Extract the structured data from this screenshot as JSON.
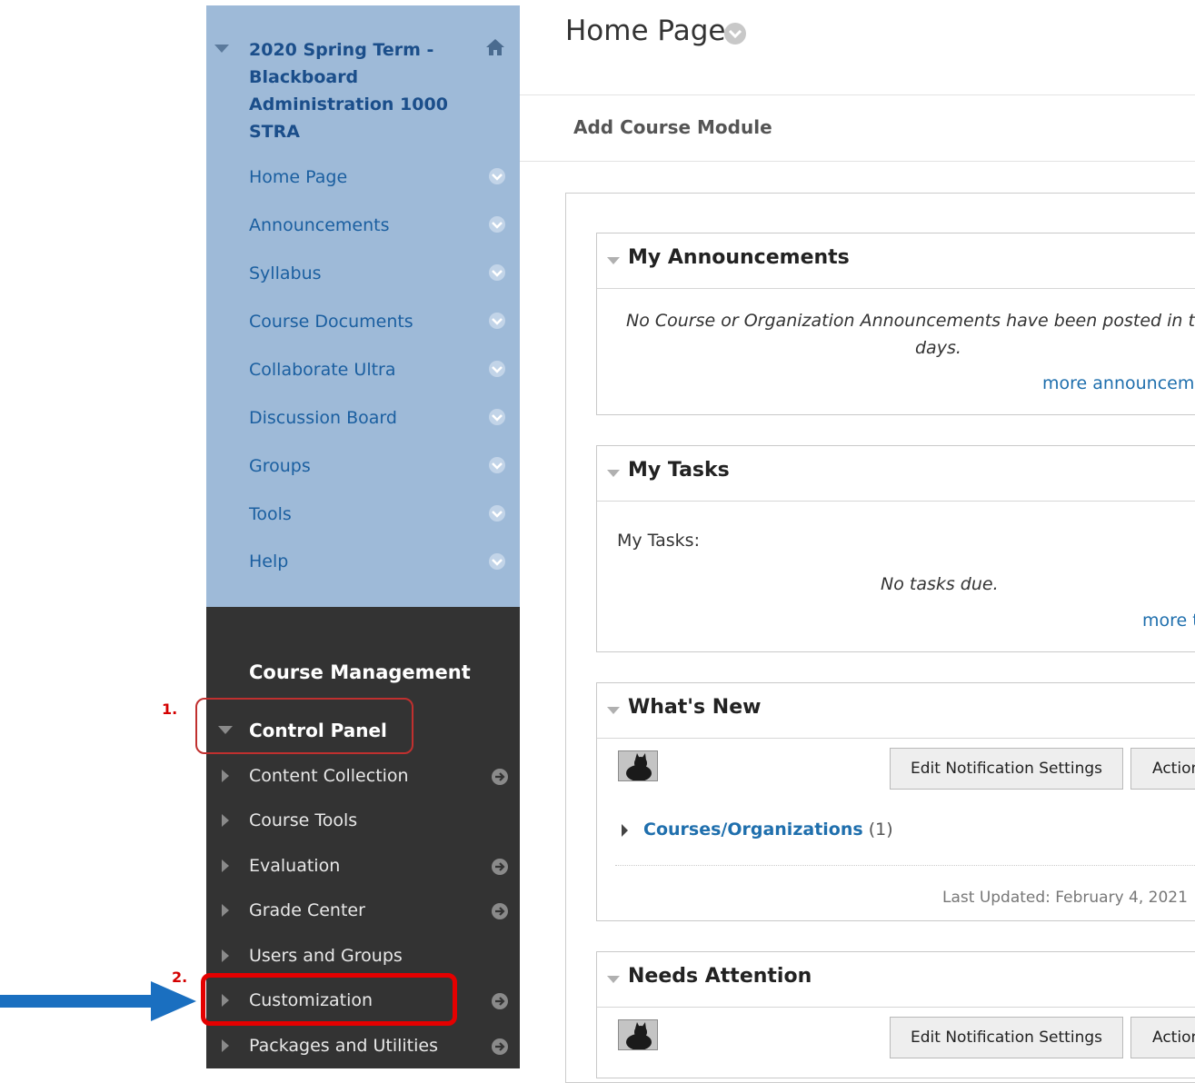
{
  "sidebar": {
    "course_title": "2020 Spring Term - Blackboard Administration 1000 STRA",
    "items": [
      {
        "label": "Home Page"
      },
      {
        "label": "Announcements"
      },
      {
        "label": "Syllabus"
      },
      {
        "label": "Course Documents"
      },
      {
        "label": "Collaborate Ultra"
      },
      {
        "label": "Discussion Board"
      },
      {
        "label": "Groups"
      },
      {
        "label": "Tools"
      },
      {
        "label": "Help"
      }
    ]
  },
  "course_management": {
    "title": "Course Management",
    "control_panel": "Control Panel",
    "items": [
      {
        "label": "Content Collection"
      },
      {
        "label": "Course Tools"
      },
      {
        "label": "Evaluation"
      },
      {
        "label": "Grade Center"
      },
      {
        "label": "Users and Groups"
      },
      {
        "label": "Customization"
      },
      {
        "label": "Packages and Utilities"
      }
    ]
  },
  "annotations": {
    "step1": "1.",
    "step2": "2."
  },
  "main": {
    "page_title": "Home Page",
    "add_module": "Add Course Module",
    "modules": {
      "announcements": {
        "title": "My Announcements",
        "message_line1": "No Course or Organization Announcements have been posted in the",
        "message_line2": "days.",
        "more_link": "more announcements"
      },
      "tasks": {
        "title": "My Tasks",
        "label": "My Tasks:",
        "message": "No tasks due.",
        "more_link": "more tasks"
      },
      "whats_new": {
        "title": "What's New",
        "edit_button": "Edit Notification Settings",
        "actions_button": "Actions",
        "courses_link": "Courses/Organizations",
        "courses_count": "(1)",
        "last_updated": "Last Updated: February 4, 2021"
      },
      "needs_attention": {
        "title": "Needs Attention",
        "edit_button": "Edit Notification Settings",
        "actions_button": "Actions"
      }
    }
  },
  "colors": {
    "sidebar_blue": "#9ebad8",
    "sidebar_dark": "#333333",
    "link_blue": "#1f6fad",
    "highlight_red": "#e40000",
    "pointer_arrow": "#1a6fc0"
  },
  "icons": [
    "home-icon",
    "chevron-down-icon",
    "arrow-right-circle-icon",
    "triangle-right-icon",
    "triangle-down-icon",
    "avatar-icon",
    "pointer-arrow-icon"
  ]
}
